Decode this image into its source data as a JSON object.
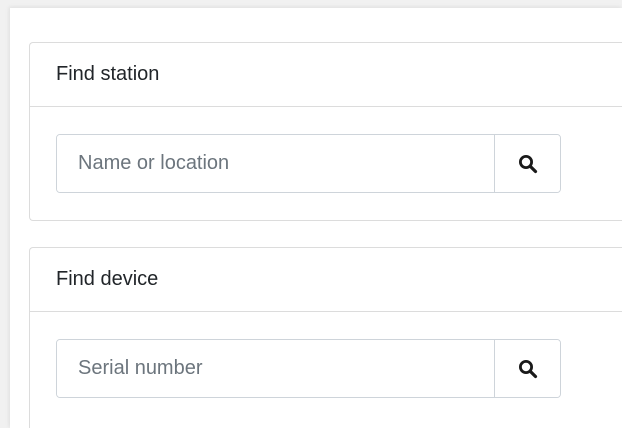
{
  "find_station": {
    "title": "Find station",
    "search_placeholder": "Name or location",
    "search_value": "",
    "button_icon": "search-icon"
  },
  "find_device": {
    "title": "Find device",
    "search_placeholder": "Serial number",
    "search_value": "",
    "button_icon": "search-icon"
  },
  "colors": {
    "border": "#dcdcdc",
    "input_border": "#ced4da",
    "placeholder": "#6c757d",
    "text": "#212529",
    "background": "#f1f1f1"
  }
}
